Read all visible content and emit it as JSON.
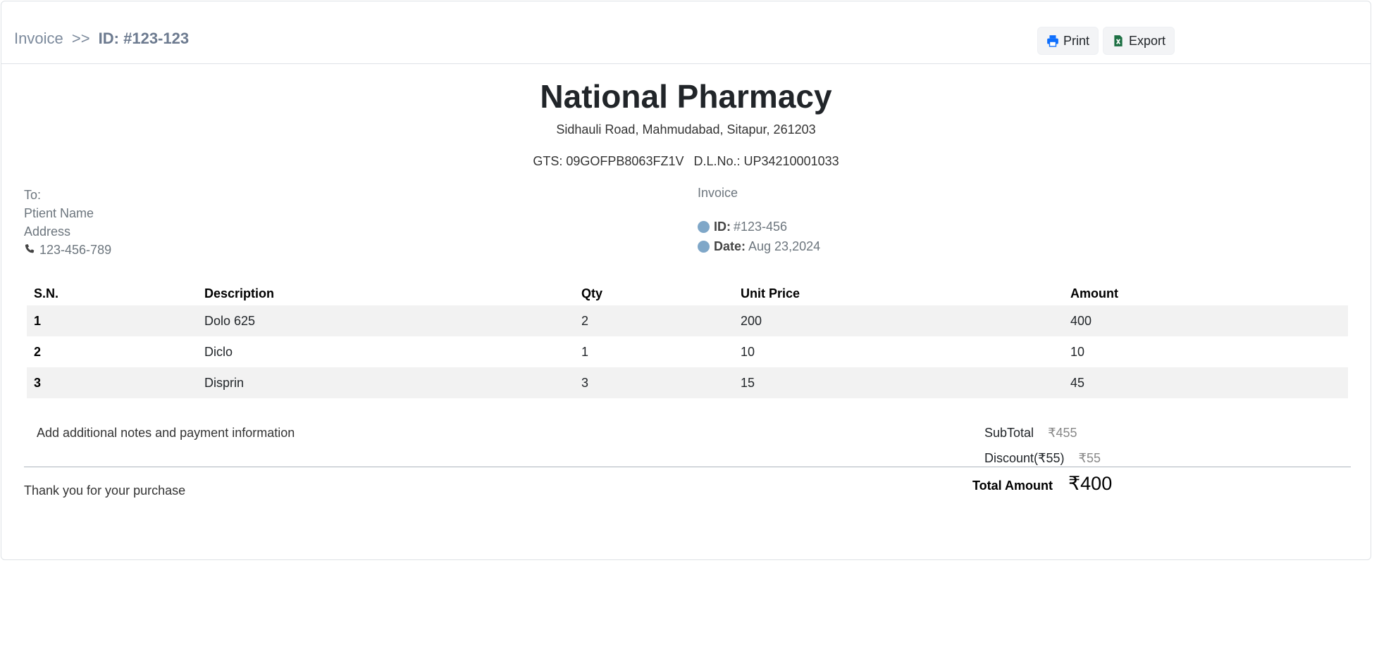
{
  "breadcrumb": {
    "root": "Invoice",
    "separator": ">>",
    "current": "ID: #123-123"
  },
  "actions": {
    "print_label": "Print",
    "export_label": "Export",
    "print_icon": "printer-icon",
    "export_icon": "excel-file-icon",
    "print_icon_color": "#0d6efd",
    "export_icon_color": "#1d7044"
  },
  "store": {
    "name": "National Pharmacy",
    "address": "Sidhauli Road, Mahmudabad, Sitapur, 261203",
    "gts": "GTS: 09GOFPB8063FZ1V",
    "dl": "D.L.No.: UP34210001033"
  },
  "to": {
    "label": "To:",
    "name": "Ptient Name",
    "address": "Address",
    "phone": "123-456-789",
    "phone_icon": "phone-icon"
  },
  "invoice": {
    "label": "Invoice",
    "id_label": "ID:",
    "id_value": "#123-456",
    "date_label": "Date:",
    "date_value": "Aug 23,2024",
    "bullet_color": "#7fa7c8"
  },
  "table": {
    "headers": [
      "S.N.",
      "Description",
      "Qty",
      "Unit Price",
      "Amount"
    ],
    "rows": [
      [
        "1",
        "Dolo 625",
        "2",
        "200",
        "400"
      ],
      [
        "2",
        "Diclo",
        "1",
        "10",
        "10"
      ],
      [
        "3",
        "Disprin",
        "3",
        "15",
        "45"
      ]
    ]
  },
  "notes": "Add additional notes and payment information",
  "summary": {
    "subtotal_label": "SubTotal",
    "subtotal_value": "₹455",
    "discount_label": "Discount(₹55)",
    "discount_value": "₹55",
    "total_label": "Total Amount",
    "total_value": "₹400"
  },
  "thanks": "Thank you for your purchase"
}
